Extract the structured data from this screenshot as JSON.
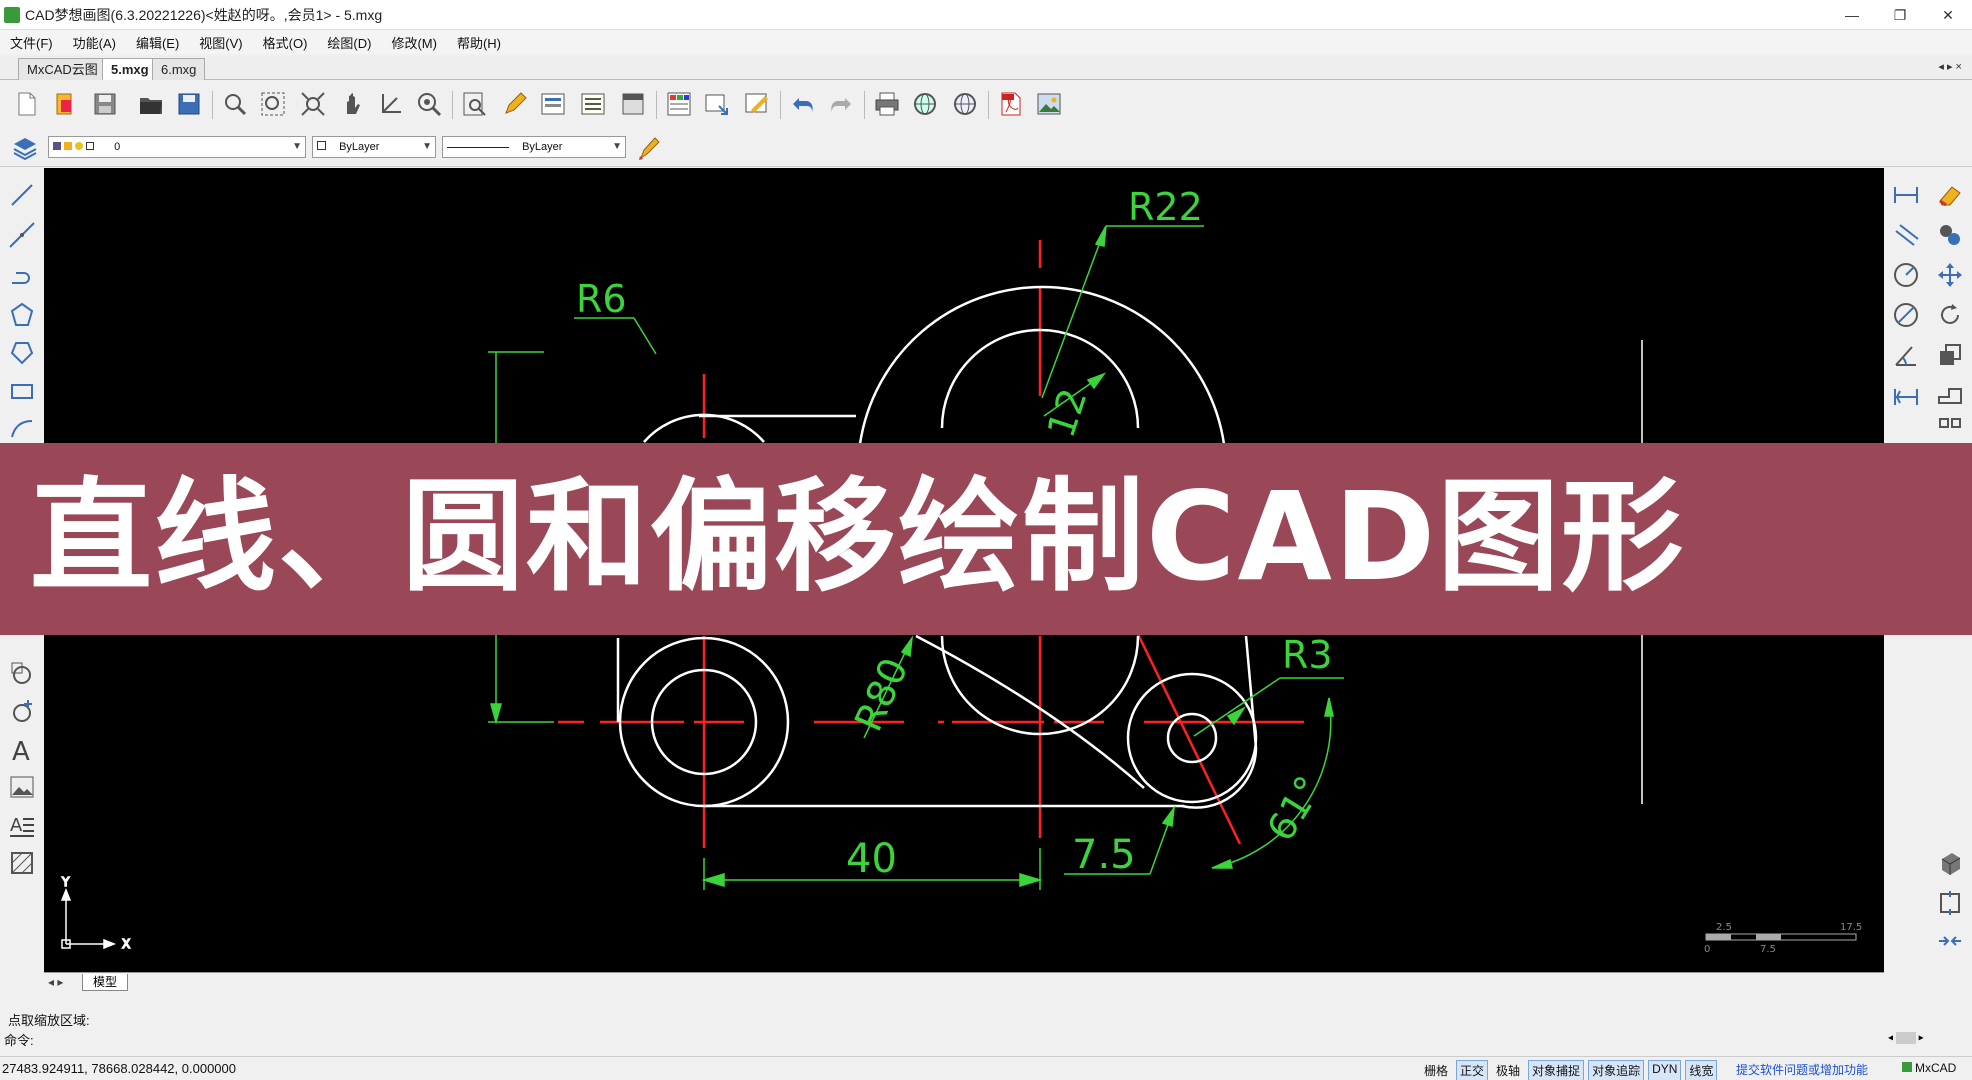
{
  "window": {
    "title": "CAD梦想画图(6.3.20221226)<姓赵的呀。,会员1> - 5.mxg",
    "controls": [
      "—",
      "❐",
      "✕"
    ]
  },
  "menu": [
    "文件(F)",
    "功能(A)",
    "编辑(E)",
    "视图(V)",
    "格式(O)",
    "绘图(D)",
    "修改(M)",
    "帮助(H)"
  ],
  "doc_tabs": {
    "items": [
      "MxCAD云图",
      "5.mxg",
      "6.mxg"
    ],
    "active": "5.mxg",
    "nav": "◂ ▸ ×"
  },
  "properties": {
    "layer": "0",
    "color": "ByLayer",
    "linetype": "ByLayer"
  },
  "drawing": {
    "dimensions": {
      "r22": "R22",
      "r6": "R6",
      "r80": "R80",
      "r3": "R3",
      "d40": "40",
      "d75": "7.5",
      "angle": "61°",
      "partial": "12"
    },
    "ucs": {
      "x": "X",
      "y": "Y"
    },
    "scale": {
      "a": "2.5",
      "b": "17.5",
      "c": "0",
      "d": "7.5"
    }
  },
  "banner": {
    "text": "直线、圆和偏移绘制CAD图形",
    "color": "#9a4858"
  },
  "layout_tabs": {
    "nav": "◂ ▸",
    "active": "模型"
  },
  "command": {
    "history": "点取缩放区域:",
    "prompt": "命令:"
  },
  "status": {
    "coords": "27483.924911, 78668.028442, 0.000000",
    "toggles": [
      {
        "label": "栅格",
        "on": false
      },
      {
        "label": "正交",
        "on": true
      },
      {
        "label": "极轴",
        "on": false
      },
      {
        "label": "对象捕捉",
        "on": true
      },
      {
        "label": "对象追踪",
        "on": true
      },
      {
        "label": "DYN",
        "on": true
      },
      {
        "label": "线宽",
        "on": true
      }
    ],
    "feedback": "提交软件问题或增加功能",
    "brand": "MxCAD"
  },
  "colors": {
    "cad_bg": "#000000",
    "geometry": "#ffffff",
    "centerline": "#ff2020",
    "dimension": "#3bd43b"
  }
}
